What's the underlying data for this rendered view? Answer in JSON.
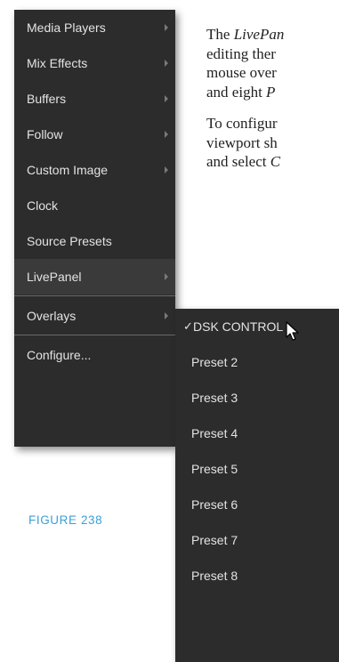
{
  "document": {
    "paragraph1": [
      {
        "prefix": "The ",
        "italic": "LivePan",
        "suffix": ""
      },
      {
        "prefix": "editing ther",
        "italic": "",
        "suffix": ""
      },
      {
        "prefix": "mouse over",
        "italic": "",
        "suffix": ""
      },
      {
        "prefix": "and eight ",
        "italic": "P",
        "suffix": ""
      }
    ],
    "paragraph2": [
      {
        "prefix": "To configur",
        "italic": "",
        "suffix": ""
      },
      {
        "prefix": "viewport sh",
        "italic": "",
        "suffix": ""
      },
      {
        "prefix": "and select ",
        "italic": "C",
        "suffix": ""
      }
    ],
    "caption": "FIGURE 238"
  },
  "main_menu": {
    "items": [
      {
        "label": "Media Players",
        "submenu": true
      },
      {
        "label": "Mix Effects",
        "submenu": true
      },
      {
        "label": "Buffers",
        "submenu": true
      },
      {
        "label": "Follow",
        "submenu": true
      },
      {
        "label": "Custom Image",
        "submenu": true
      },
      {
        "label": "Clock",
        "submenu": false
      },
      {
        "label": "Source Presets",
        "submenu": false
      },
      {
        "label": "LivePanel",
        "submenu": true,
        "active": true
      },
      {
        "label": "Overlays",
        "submenu": true
      },
      {
        "label": "Configure...",
        "submenu": false
      }
    ]
  },
  "sub_menu": {
    "check_glyph": "✓",
    "items": [
      {
        "label": "DSK CONTROL",
        "checked": true
      },
      {
        "label": "Preset 2",
        "checked": false
      },
      {
        "label": "Preset 3",
        "checked": false
      },
      {
        "label": "Preset 4",
        "checked": false
      },
      {
        "label": "Preset 5",
        "checked": false
      },
      {
        "label": "Preset 6",
        "checked": false
      },
      {
        "label": "Preset 7",
        "checked": false
      },
      {
        "label": "Preset 8",
        "checked": false
      }
    ]
  },
  "colors": {
    "menu_bg": "#2c2c2c",
    "menu_text": "#e3e3e3",
    "separator": "#6a6a6a",
    "caption": "#3aa0d8"
  }
}
